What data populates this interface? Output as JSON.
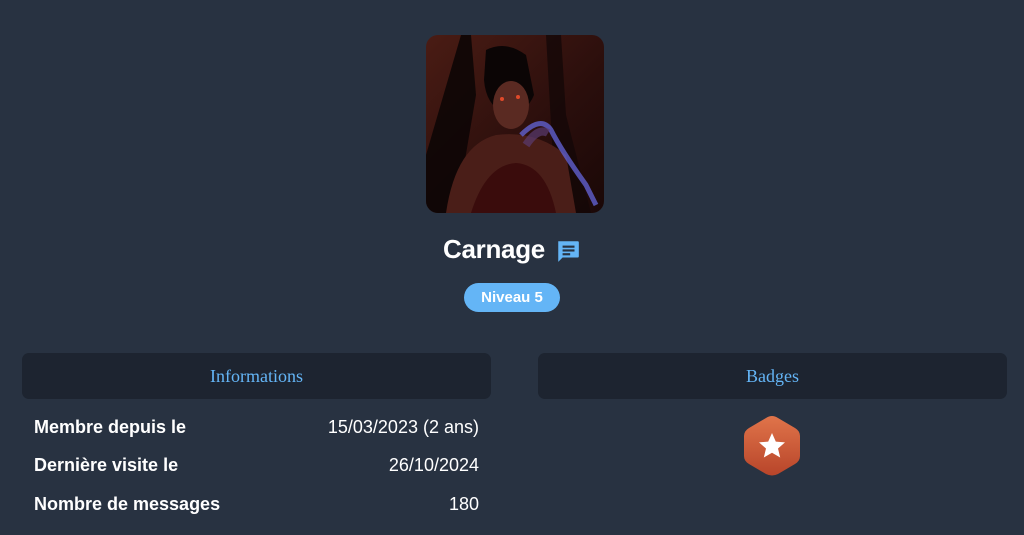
{
  "profile": {
    "username": "Carnage",
    "level": "Niveau 5",
    "avatar_icon": "user-avatar-image",
    "message_icon": "chat-message-icon"
  },
  "info": {
    "heading": "Informations",
    "rows": [
      {
        "label": "Membre depuis le",
        "value": "15/03/2023 (2 ans)"
      },
      {
        "label": "Dernière visite le",
        "value": "26/10/2024"
      },
      {
        "label": "Nombre de messages",
        "value": "180"
      }
    ]
  },
  "badges": {
    "heading": "Badges",
    "items": [
      {
        "icon": "star-hexagon-badge-icon",
        "color": "#d0603a"
      }
    ]
  },
  "colors": {
    "background": "#283241",
    "panel_header": "#1d2430",
    "accent": "#64b5f6",
    "text": "#ffffff"
  }
}
